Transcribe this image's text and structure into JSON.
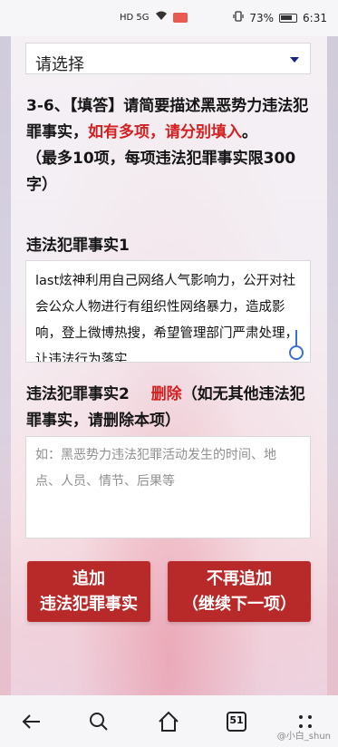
{
  "status_bar": {
    "network": "HD 5G",
    "battery": "73%",
    "time": "6:31"
  },
  "select": {
    "value": "请选择"
  },
  "question": {
    "prefix": "3-6、【填答】请简要描述黑恶势力违法犯罪事实，",
    "red_text": "如有多项，请分别填入",
    "suffix": "。",
    "note": "（最多10项，每项违法犯罪事实限300字）"
  },
  "fact1": {
    "label": "违法犯罪事实1",
    "text": "last炫神利用自己网络人气影响力，公开对社会公众人物进行有组织性网络暴力，造成影响，登上微博热搜，希望管理部门严肃处理，让违法行为落实"
  },
  "fact2": {
    "label": "违法犯罪事实2",
    "delete_label": "删除",
    "hint": "（如无其他违法犯罪事实，请删除本项）",
    "placeholder": "如：黑恶势力违法犯罪活动发生的时间、地点、人员、情节、后果等"
  },
  "buttons": {
    "add_line1": "追加",
    "add_line2": "违法犯罪事实",
    "next_line1": "不再追加",
    "next_line2": "（继续下一项）"
  },
  "nav": {
    "tab_count": "51",
    "watermark": "@小白_shun"
  }
}
